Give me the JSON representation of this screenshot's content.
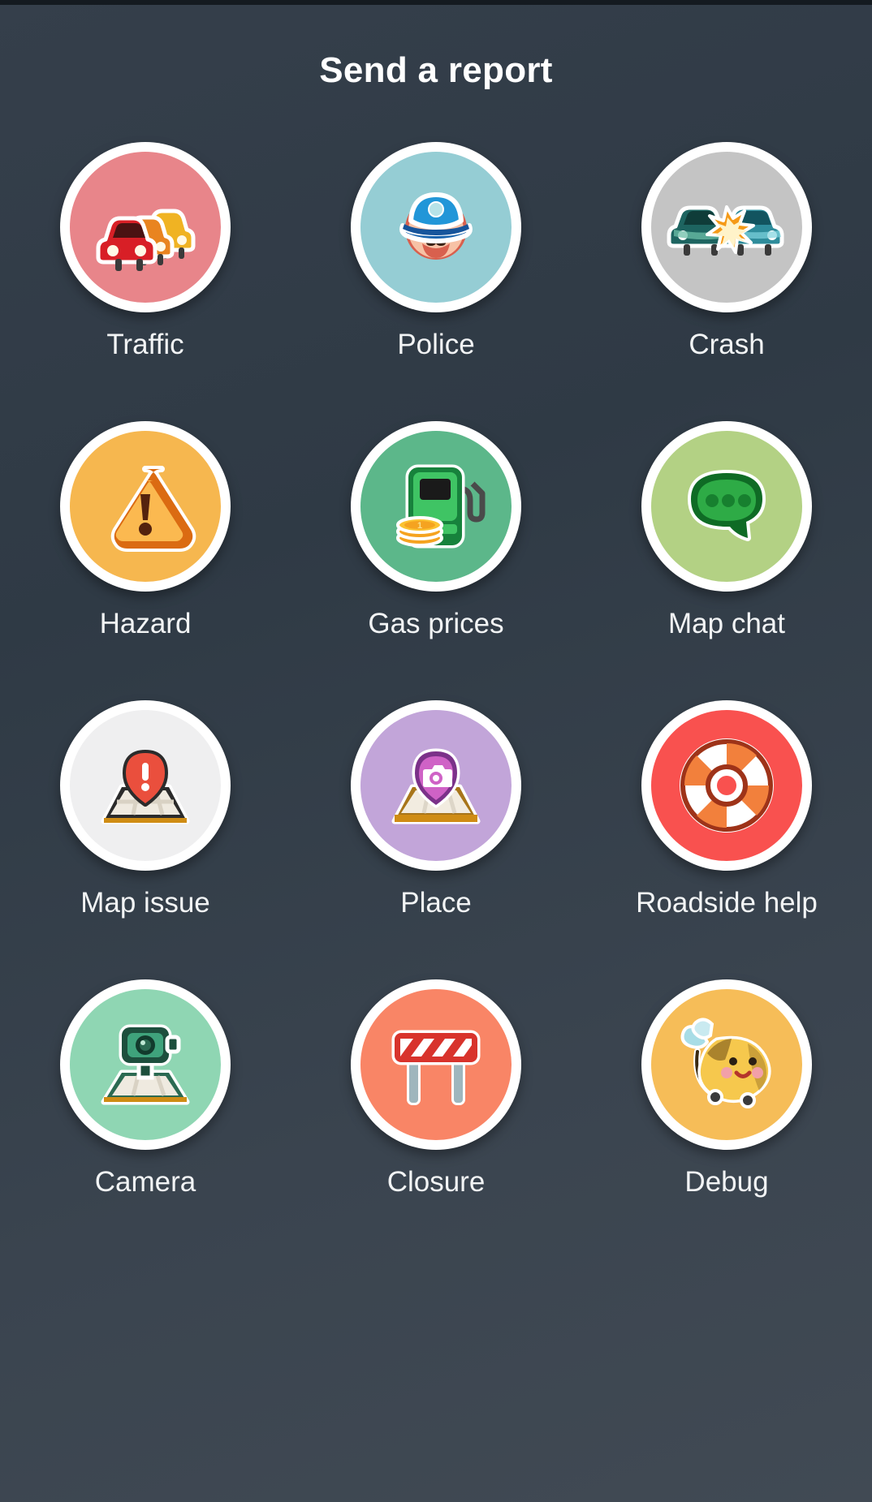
{
  "header": {
    "title": "Send a report"
  },
  "theme": {
    "background": "#333f4a",
    "title_color": "#ffffff",
    "label_color": "#f2f4f5",
    "ring_color": "#ffffff"
  },
  "grid": {
    "columns": 3,
    "rows": 4,
    "items": [
      {
        "id": "traffic",
        "label": "Traffic",
        "icon": "traffic-cars-icon",
        "disc_color": "#e8858a"
      },
      {
        "id": "police",
        "label": "Police",
        "icon": "police-officer-icon",
        "disc_color": "#95cdd4"
      },
      {
        "id": "crash",
        "label": "Crash",
        "icon": "car-crash-icon",
        "disc_color": "#c4c4c4"
      },
      {
        "id": "hazard",
        "label": "Hazard",
        "icon": "warning-triangle-icon",
        "disc_color": "#f6b74f"
      },
      {
        "id": "gas-prices",
        "label": "Gas prices",
        "icon": "gas-pump-coins-icon",
        "disc_color": "#5cb78a"
      },
      {
        "id": "map-chat",
        "label": "Map chat",
        "icon": "chat-bubble-icon",
        "disc_color": "#b3d184"
      },
      {
        "id": "map-issue",
        "label": "Map issue",
        "icon": "map-pin-alert-icon",
        "disc_color": "#efeff0"
      },
      {
        "id": "place",
        "label": "Place",
        "icon": "map-pin-camera-icon",
        "disc_color": "#c2a5d9"
      },
      {
        "id": "roadside-help",
        "label": "Roadside help",
        "icon": "life-ring-icon",
        "disc_color": "#f9514f"
      },
      {
        "id": "camera",
        "label": "Camera",
        "icon": "speed-camera-icon",
        "disc_color": "#8fd6b3"
      },
      {
        "id": "closure",
        "label": "Closure",
        "icon": "road-barrier-icon",
        "disc_color": "#f98566"
      },
      {
        "id": "debug",
        "label": "Debug",
        "icon": "bee-icon",
        "disc_color": "#f6bd58"
      }
    ]
  }
}
